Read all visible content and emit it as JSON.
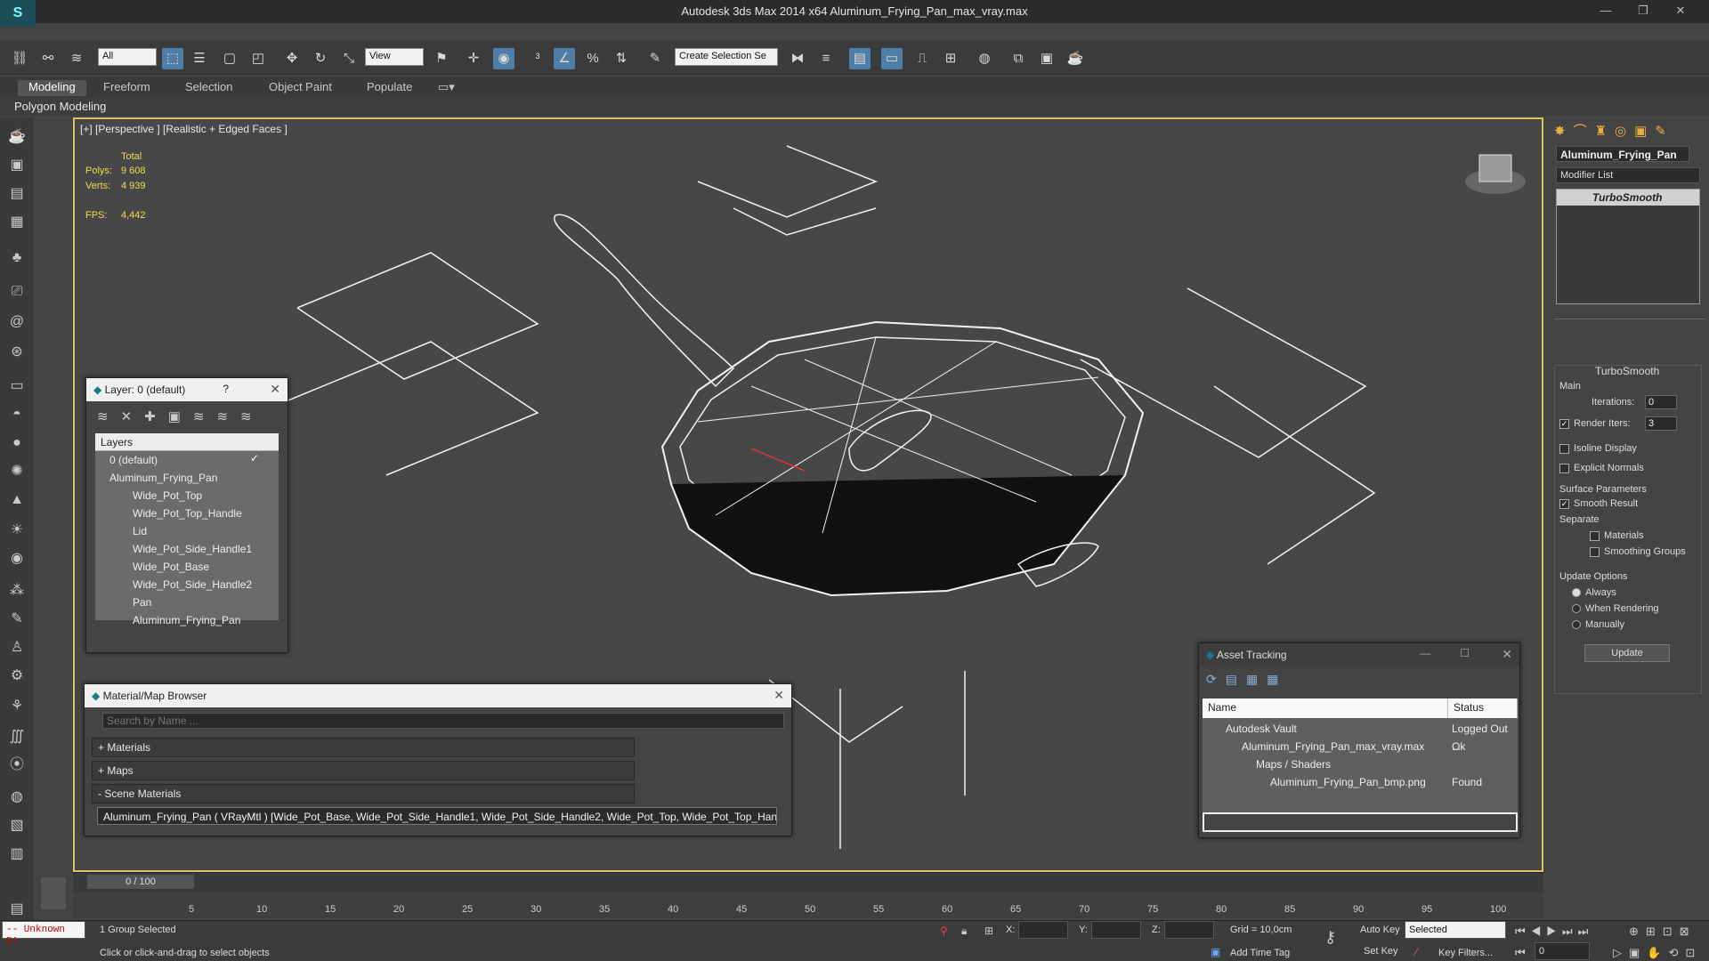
{
  "titlebar": {
    "title": "Autodesk 3ds Max  2014 x64     Aluminum_Frying_Pan_max_vray.max"
  },
  "toolbar": {
    "filter_dropdown": "All",
    "view_dropdown": "View",
    "selection_set": "Create Selection Se"
  },
  "ribbon": {
    "tabs": [
      "Modeling",
      "Freeform",
      "Selection",
      "Object Paint",
      "Populate"
    ],
    "active": "Modeling",
    "sub_label": "Polygon Modeling"
  },
  "viewport": {
    "label": "[+] [Perspective ] [Realistic + Edged Faces ]",
    "stats": {
      "total_label": "Total",
      "polys_label": "Polys:",
      "polys": "9 608",
      "verts_label": "Verts:",
      "verts": "4 939",
      "fps_label": "FPS:",
      "fps": "4,442"
    }
  },
  "layer_panel": {
    "title": "Layer: 0 (default)",
    "help": "?",
    "column": "Layers",
    "items": [
      "0 (default)",
      "Aluminum_Frying_Pan",
      "Wide_Pot_Top",
      "Wide_Pot_Top_Handle",
      "Lid",
      "Wide_Pot_Side_Handle1",
      "Wide_Pot_Base",
      "Wide_Pot_Side_Handle2",
      "Pan",
      "Aluminum_Frying_Pan"
    ]
  },
  "material_browser": {
    "title": "Material/Map Browser",
    "search_placeholder": "Search by Name ...",
    "sections": [
      "+ Materials",
      "+ Maps",
      "- Scene Materials"
    ],
    "scene_material": "Aluminum_Frying_Pan  ( VRayMtl ) [Wide_Pot_Base, Wide_Pot_Side_Handle1, Wide_Pot_Side_Handle2, Wide_Pot_Top, Wide_Pot_Top_Handle]"
  },
  "asset_tracking": {
    "title": "Asset Tracking",
    "columns": [
      "Name",
      "Status"
    ],
    "rows": [
      {
        "name": "Autodesk Vault",
        "status": "Logged Out ..."
      },
      {
        "name": "Aluminum_Frying_Pan_max_vray.max",
        "status": "Ok"
      },
      {
        "name": "Maps / Shaders",
        "status": ""
      },
      {
        "name": "Aluminum_Frying_Pan_bmp.png",
        "status": "Found"
      }
    ]
  },
  "command_panel": {
    "object_name": "Aluminum_Frying_Pan",
    "modifier_list": "Modifier List",
    "modifier": "TurboSmooth",
    "rollout_title": "TurboSmooth",
    "main_label": "Main",
    "iterations_label": "Iterations:",
    "iterations": "0",
    "render_iters_label": "Render Iters:",
    "render_iters": "3",
    "isoline": "Isoline Display",
    "explicit": "Explicit Normals",
    "surface_label": "Surface Parameters",
    "smooth_result": "Smooth Result",
    "separate_label": "Separate",
    "materials": "Materials",
    "smoothing_groups": "Smoothing Groups",
    "update_label": "Update Options",
    "always": "Always",
    "when_rendering": "When Rendering",
    "manually": "Manually",
    "update_button": "Update"
  },
  "timeline": {
    "frame": "0 / 100",
    "ticks": [
      "5",
      "10",
      "15",
      "20",
      "25",
      "30",
      "35",
      "40",
      "45",
      "50",
      "55",
      "60",
      "65",
      "70",
      "75",
      "80",
      "85",
      "90",
      "95",
      "100"
    ]
  },
  "status": {
    "script": "-- Unknown p:",
    "selection": "1 Group Selected",
    "prompt": "Click or click-and-drag to select objects",
    "x_label": "X:",
    "y_label": "Y:",
    "z_label": "Z:",
    "grid": "Grid = 10,0cm",
    "auto_key": "Auto Key",
    "selected": "Selected",
    "set_key": "Set Key",
    "key_filters": "Key Filters...",
    "add_time_tag": "Add Time Tag",
    "frame_field": "0"
  }
}
